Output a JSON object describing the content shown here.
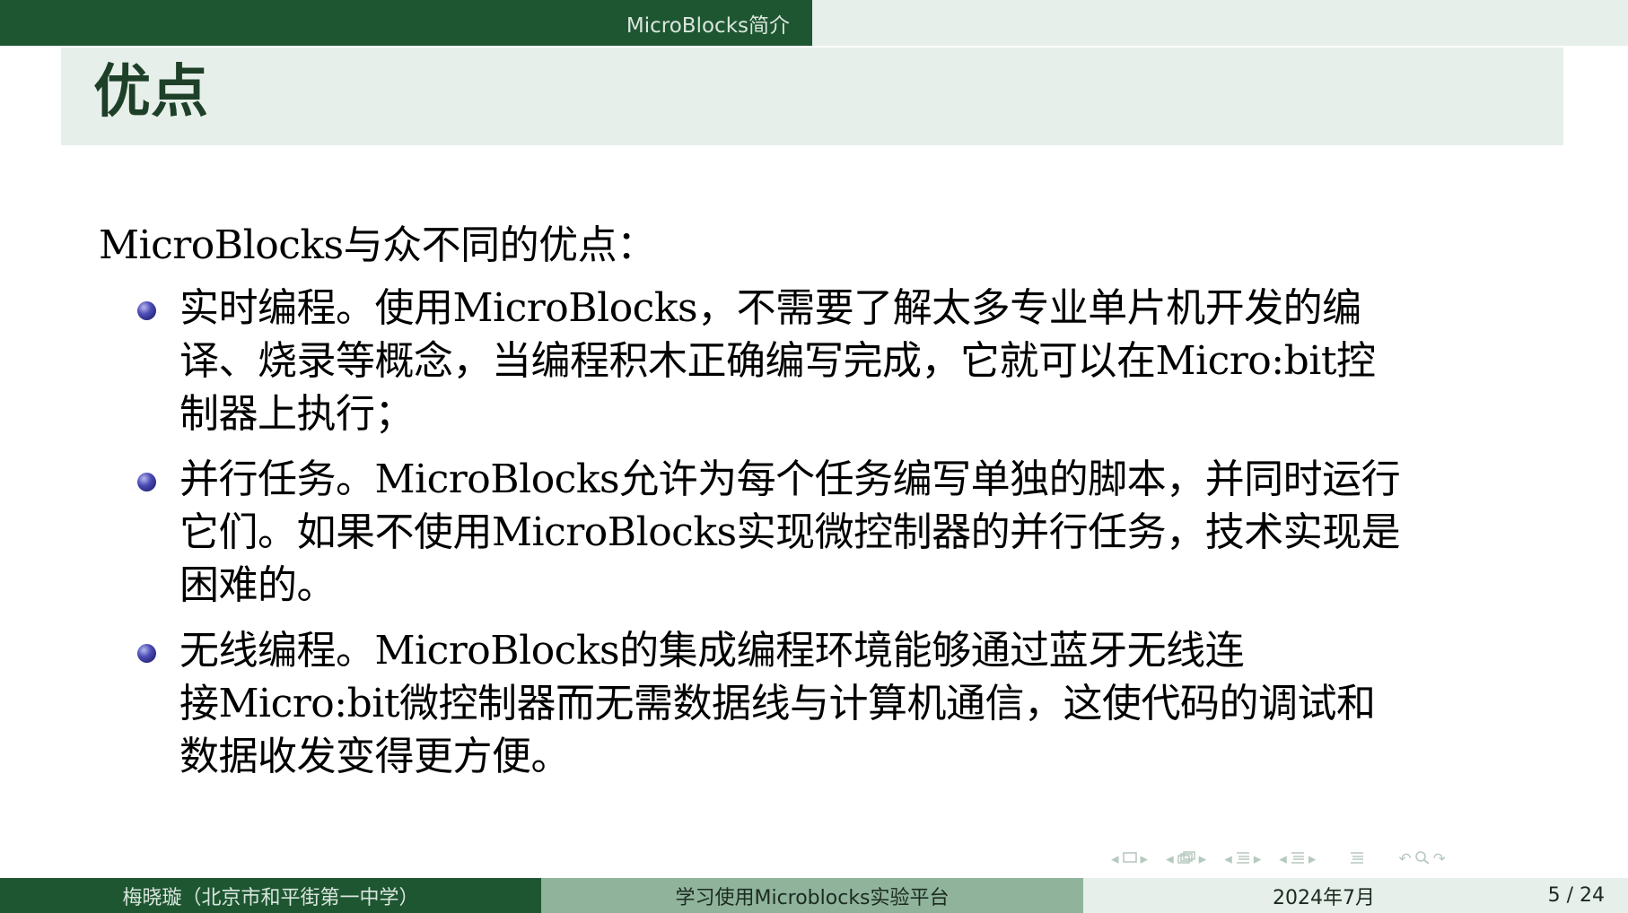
{
  "header": {
    "section_title": "MicroBlocks简介"
  },
  "frame": {
    "title": "优点"
  },
  "content": {
    "intro": "MicroBlocks与众不同的优点：",
    "bullets": [
      {
        "lines": [
          "实时编程。使用MicroBlocks，不需要了解太多专业单片机开发的编",
          "译、烧录等概念，当编程积木正确编写完成，它就可以在Micro:bit控",
          "制器上执行；"
        ]
      },
      {
        "lines": [
          "并行任务。MicroBlocks允许为每个任务编写单独的脚本，并同时运行",
          "它们。如果不使用MicroBlocks实现微控制器的并行任务，技术实现是",
          "困难的。"
        ]
      },
      {
        "lines": [
          "无线编程。MicroBlocks的集成编程环境能够通过蓝牙无线连",
          "接Micro:bit微控制器而无需数据线与计算机通信，这使代码的调试和",
          "数据收发变得更方便。"
        ]
      }
    ]
  },
  "nav": {
    "icons": [
      "nav-prev-icon",
      "frame-icon",
      "nav-next-icon",
      "nav-prev-icon",
      "subsection-icon",
      "nav-next-icon",
      "nav-prev-icon",
      "section-icon",
      "nav-next-icon",
      "nav-prev-icon",
      "document-icon",
      "nav-next-icon",
      "toc-icon",
      "undo-icon",
      "search-icon",
      "redo-icon"
    ]
  },
  "footer": {
    "author": "梅晓璇（北京市和平街第一中学）",
    "talk_title": "学习使用Microblocks实验平台",
    "date": "2024年7月",
    "page": "5 / 24"
  },
  "colors": {
    "primary": "#1e5631",
    "light": "#e6efe9",
    "mid": "#8fb39b",
    "bullet": "#3a3aa0"
  }
}
